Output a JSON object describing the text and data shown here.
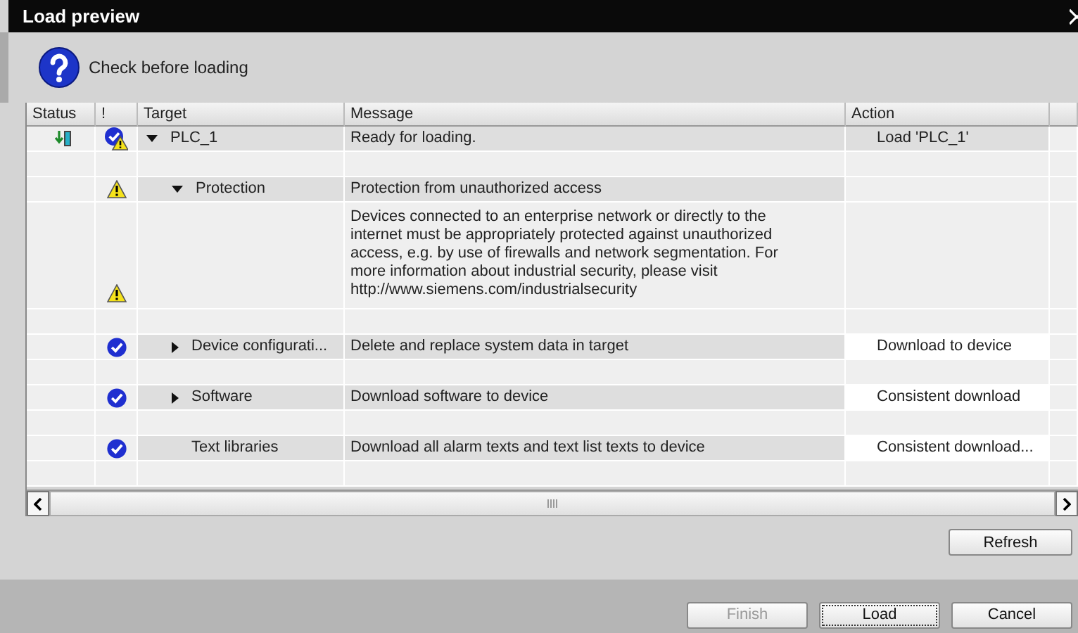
{
  "window": {
    "title": "Load preview"
  },
  "prompt": "Check before loading",
  "table": {
    "columns": [
      "Status",
      "!",
      "Target",
      "Message",
      "Action"
    ],
    "rows": [
      {
        "loadable": true,
        "ok": true,
        "warning": true,
        "target": "PLC_1",
        "expanded": true,
        "message": "Ready for loading.",
        "action": "Load 'PLC_1'",
        "action_editable": false,
        "children": [
          {
            "ok": false,
            "warning": true,
            "target": "Protection",
            "expanded": true,
            "message": "Protection from unauthorized access",
            "details": "Devices connected to an enterprise network or directly to the internet must be appropriately protected against unauthorized access, e.g. by use of firewalls and network segmentation. For more information about industrial security, please visit http://www.siemens.com/industrialsecurity",
            "details_warning": true
          },
          {
            "ok": true,
            "warning": false,
            "target": "Device configurati...",
            "expanded": false,
            "message": "Delete and replace system data in target",
            "action": "Download to device",
            "action_editable": true
          },
          {
            "ok": true,
            "warning": false,
            "target": "Software",
            "expanded": false,
            "message": "Download software to device",
            "action": "Consistent download",
            "action_editable": true
          },
          {
            "ok": true,
            "warning": false,
            "target": "Text libraries",
            "message": "Download all alarm texts and text list texts to device",
            "action": "Consistent download...",
            "action_editable": true
          }
        ]
      }
    ]
  },
  "refresh_button": "Refresh",
  "buttons": [
    {
      "label": "Finish",
      "disabled": true,
      "focused": false
    },
    {
      "label": "Load",
      "disabled": false,
      "focused": true
    },
    {
      "label": "Cancel",
      "disabled": false,
      "focused": false
    }
  ]
}
